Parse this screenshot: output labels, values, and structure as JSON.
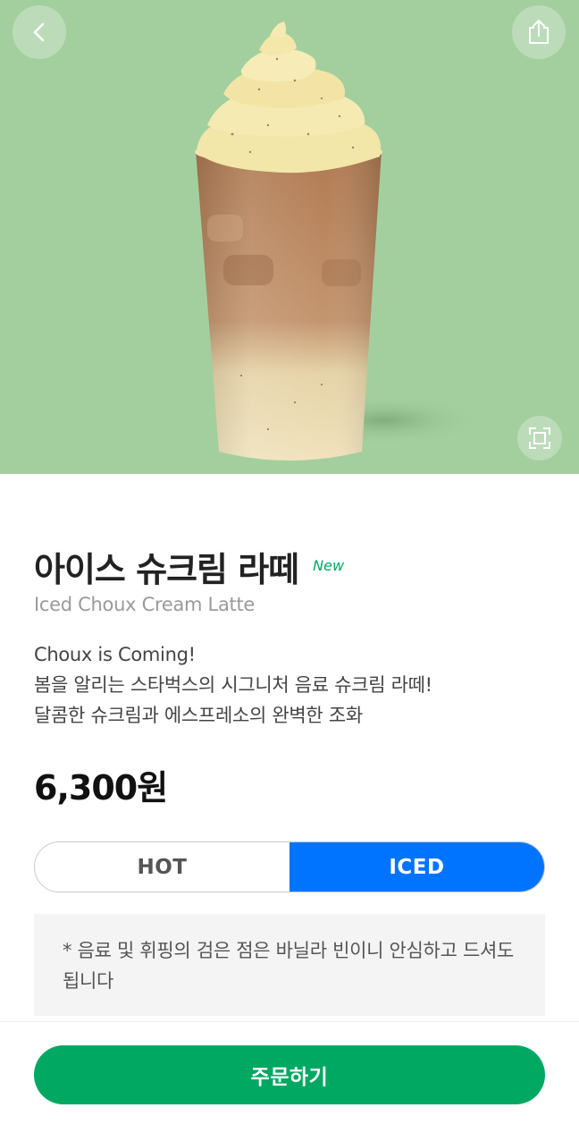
{
  "product": {
    "name_ko": "아이스 슈크림 라떼",
    "badge": "New",
    "name_en": "Iced Choux Cream Latte",
    "description_lines": [
      "Choux is Coming!",
      "봄을 알리는 스타벅스의 시그니처 음료 슈크림 라떼!",
      "달콤한 슈크림과 에스프레소의 완벽한 조화"
    ],
    "price": "6,300원"
  },
  "temperature_options": {
    "hot_label": "HOT",
    "iced_label": "ICED",
    "selected": "ICED"
  },
  "notice": "* 음료 및 휘핑의 검은 점은 바닐라 빈이니 안심하고 드셔도 됩니다",
  "order_button_label": "주문하기",
  "icons": {
    "back": "chevron-left-icon",
    "share": "share-icon",
    "expand": "expand-icon"
  },
  "colors": {
    "hero_background": "#a3cf9e",
    "accent_green": "#00a862",
    "selected_blue": "#0073ff"
  }
}
